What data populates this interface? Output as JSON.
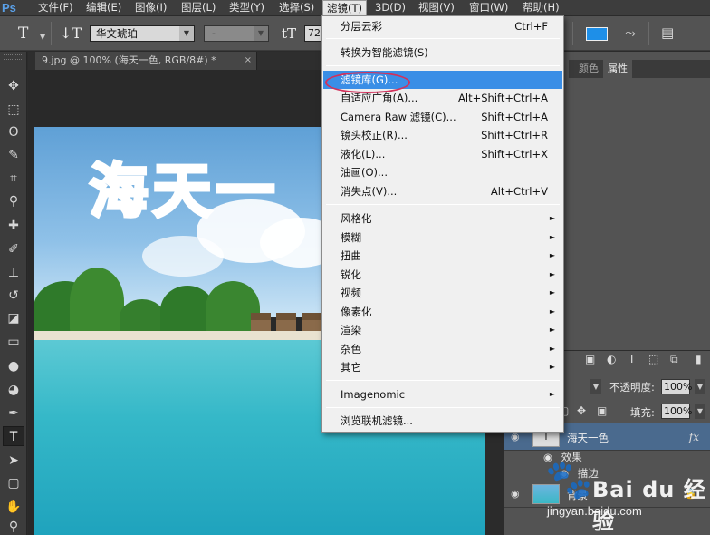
{
  "app": {
    "logo": "Ps"
  },
  "menubar": {
    "items": [
      "文件(F)",
      "编辑(E)",
      "图像(I)",
      "图层(L)",
      "类型(Y)",
      "选择(S)",
      "滤镜(T)",
      "3D(D)",
      "视图(V)",
      "窗口(W)",
      "帮助(H)"
    ],
    "active": "滤镜(T)"
  },
  "options": {
    "tool_glyph": "T",
    "orient_glyph": "↓T",
    "font_family": "华文琥珀",
    "font_style": "-",
    "size_glyph": "tT",
    "font_size": "72",
    "text_color": "#1e8fe8"
  },
  "document": {
    "tab_title": "9.jpg @ 100% (海天一色, RGB/8#) *",
    "close_glyph": "×",
    "headline": "海天一"
  },
  "panels": {
    "tabs": [
      "颜色",
      "属性"
    ],
    "opacity_label": "不透明度:",
    "opacity_value": "100%",
    "fill_label": "填充:",
    "fill_value": "100%",
    "layers": [
      {
        "name": "海天一色",
        "fx": "fx",
        "type": "text"
      },
      {
        "name": "效果"
      },
      {
        "name": "描边"
      },
      {
        "name": "背景",
        "type": "image"
      }
    ]
  },
  "filter_menu": {
    "groups": [
      [
        {
          "label": "分层云彩",
          "shortcut": "Ctrl+F"
        }
      ],
      [
        {
          "label": "转换为智能滤镜(S)"
        }
      ],
      [
        {
          "label": "滤镜库(G)...",
          "highlighted": true
        },
        {
          "label": "自适应广角(A)...",
          "shortcut": "Alt+Shift+Ctrl+A"
        },
        {
          "label": "Camera Raw 滤镜(C)...",
          "shortcut": "Shift+Ctrl+A"
        },
        {
          "label": "镜头校正(R)...",
          "shortcut": "Shift+Ctrl+R"
        },
        {
          "label": "液化(L)...",
          "shortcut": "Shift+Ctrl+X"
        },
        {
          "label": "油画(O)..."
        },
        {
          "label": "消失点(V)...",
          "shortcut": "Alt+Ctrl+V"
        }
      ],
      [
        {
          "label": "风格化",
          "submenu": true
        },
        {
          "label": "模糊",
          "submenu": true
        },
        {
          "label": "扭曲",
          "submenu": true
        },
        {
          "label": "锐化",
          "submenu": true
        },
        {
          "label": "视频",
          "submenu": true
        },
        {
          "label": "像素化",
          "submenu": true
        },
        {
          "label": "渲染",
          "submenu": true
        },
        {
          "label": "杂色",
          "submenu": true
        },
        {
          "label": "其它",
          "submenu": true
        }
      ],
      [
        {
          "label": "Imagenomic",
          "submenu": true
        }
      ],
      [
        {
          "label": "浏览联机滤镜..."
        }
      ]
    ],
    "highlight_ring_color": "#d2315b"
  },
  "watermark": {
    "brand": "Bai du 经验",
    "url": "jingyan.baidu.com"
  }
}
